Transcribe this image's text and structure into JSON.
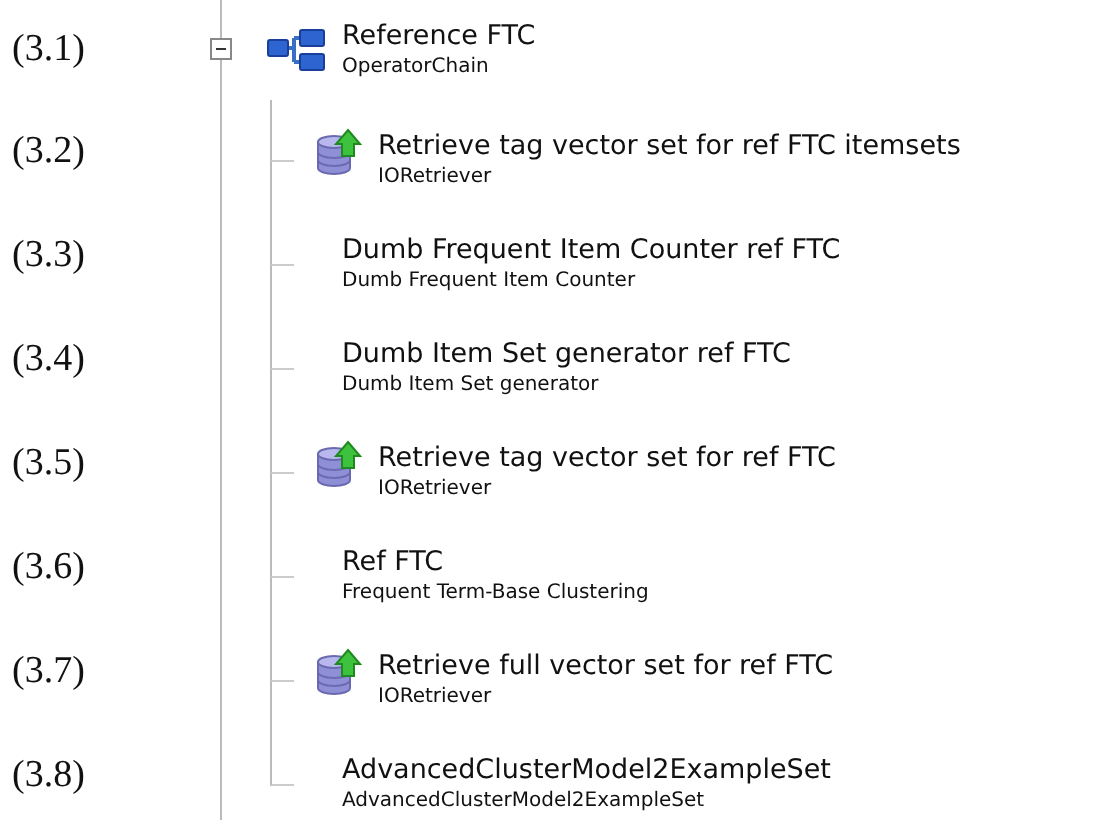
{
  "tree": {
    "number": "(3.1)",
    "label": "Reference FTC",
    "type": "OperatorChain",
    "kind": "chain",
    "expanded": true,
    "children": [
      {
        "number": "(3.2)",
        "label": "Retrieve tag vector set for ref FTC itemsets",
        "type": "IORetriever",
        "kind": "retriever"
      },
      {
        "number": "(3.3)",
        "label": "Dumb Frequent Item Counter ref FTC",
        "type": "Dumb Frequent Item Counter",
        "kind": "plain"
      },
      {
        "number": "(3.4)",
        "label": "Dumb Item Set generator ref FTC",
        "type": "Dumb Item Set generator",
        "kind": "plain"
      },
      {
        "number": "(3.5)",
        "label": "Retrieve tag vector set for ref FTC",
        "type": "IORetriever",
        "kind": "retriever"
      },
      {
        "number": "(3.6)",
        "label": "Ref FTC",
        "type": "Frequent Term-Base Clustering",
        "kind": "plain"
      },
      {
        "number": "(3.7)",
        "label": "Retrieve full vector set for ref FTC",
        "type": "IORetriever",
        "kind": "retriever"
      },
      {
        "number": "(3.8)",
        "label": "AdvancedClusterModel2ExampleSet",
        "type": "AdvancedClusterModel2ExampleSet",
        "kind": "plain"
      }
    ]
  }
}
